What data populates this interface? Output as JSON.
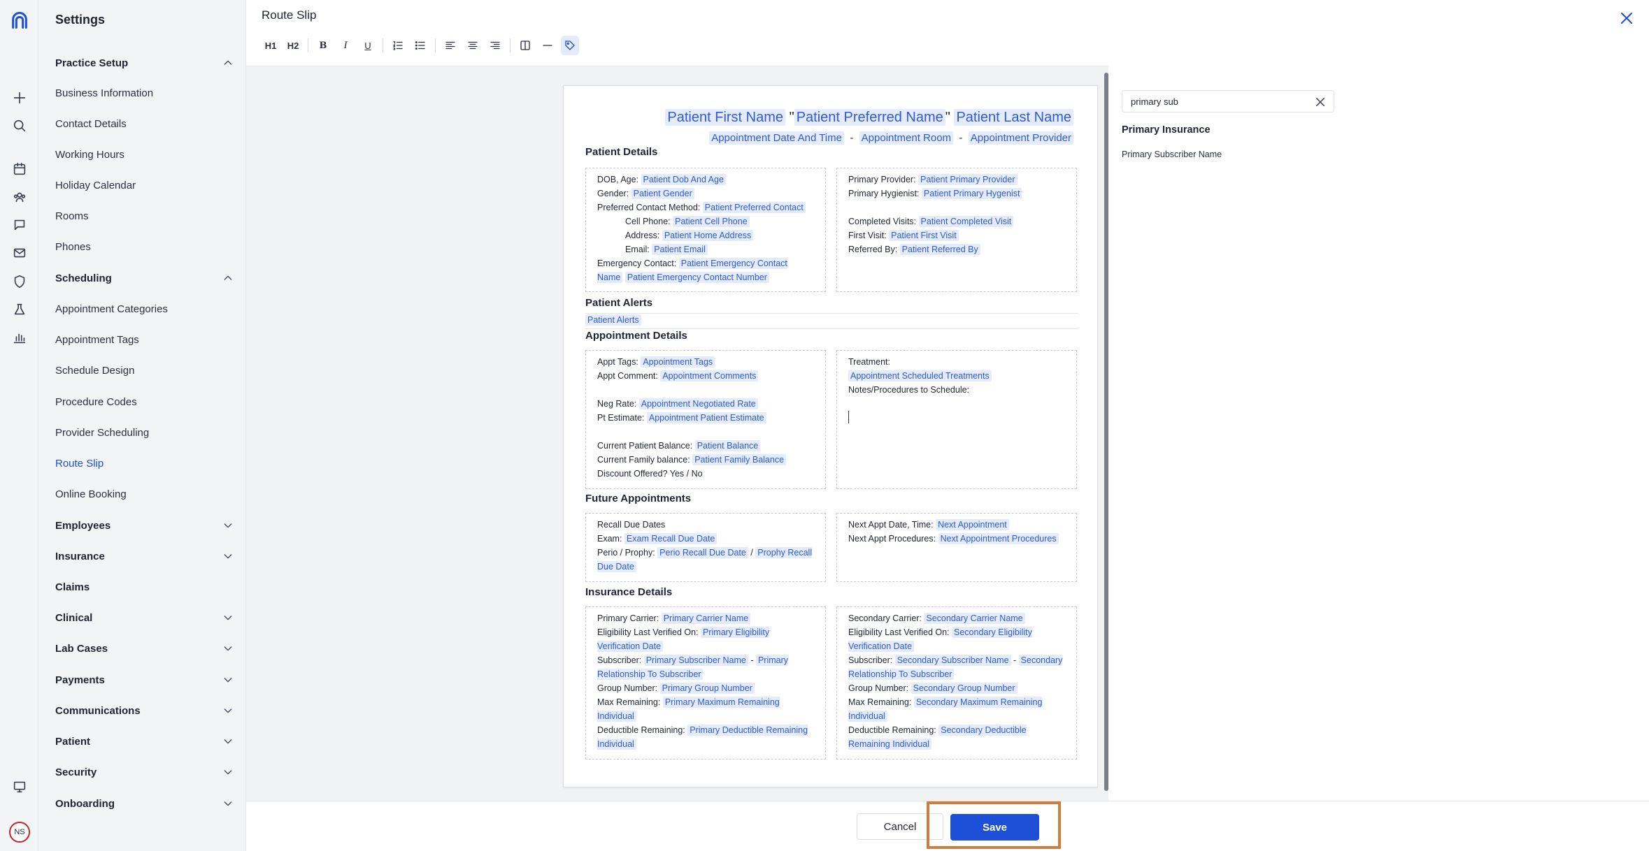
{
  "sidebar": {
    "title": "Settings",
    "avatar_initials": "NS",
    "items": [
      {
        "label": "Practice Setup",
        "type": "section",
        "chevron": "up"
      },
      {
        "label": "Business Information",
        "type": "item"
      },
      {
        "label": "Contact Details",
        "type": "item"
      },
      {
        "label": "Working Hours",
        "type": "item"
      },
      {
        "label": "Holiday Calendar",
        "type": "item"
      },
      {
        "label": "Rooms",
        "type": "item"
      },
      {
        "label": "Phones",
        "type": "item"
      },
      {
        "label": "Scheduling",
        "type": "section",
        "chevron": "up"
      },
      {
        "label": "Appointment Categories",
        "type": "item"
      },
      {
        "label": "Appointment Tags",
        "type": "item"
      },
      {
        "label": "Schedule Design",
        "type": "item"
      },
      {
        "label": "Procedure Codes",
        "type": "item"
      },
      {
        "label": "Provider Scheduling",
        "type": "item"
      },
      {
        "label": "Route Slip",
        "type": "item",
        "active": true
      },
      {
        "label": "Online Booking",
        "type": "item"
      },
      {
        "label": "Employees",
        "type": "section",
        "chevron": "down"
      },
      {
        "label": "Insurance",
        "type": "section",
        "chevron": "down"
      },
      {
        "label": "Claims",
        "type": "section"
      },
      {
        "label": "Clinical",
        "type": "section",
        "chevron": "down"
      },
      {
        "label": "Lab Cases",
        "type": "section",
        "chevron": "down"
      },
      {
        "label": "Payments",
        "type": "section",
        "chevron": "down"
      },
      {
        "label": "Communications",
        "type": "section",
        "chevron": "down"
      },
      {
        "label": "Patient",
        "type": "section",
        "chevron": "down"
      },
      {
        "label": "Security",
        "type": "section",
        "chevron": "down"
      },
      {
        "label": "Onboarding",
        "type": "section",
        "chevron": "down"
      }
    ]
  },
  "rail_icons": [
    "app-logo-icon",
    "plus-icon",
    "search-icon",
    "schedule-icon",
    "patients-icon",
    "chat-icon",
    "mail-icon",
    "shield-icon",
    "lab-flask-icon",
    "reports-chart-icon",
    "desktop-icon"
  ],
  "editor": {
    "title": "Route Slip",
    "toolbar": {
      "h1": "H1",
      "h2": "H2",
      "bold": "B",
      "italic": "I",
      "underline": "U"
    },
    "colors": {
      "accent": "#1d4fd8",
      "tag_bg": "#e4ebfa",
      "tag_text": "#2f5bd6",
      "save_highlight": "#d07d3c"
    }
  },
  "doc": {
    "header": {
      "first_name": "Patient First Name",
      "quote": "\"",
      "preferred_name": "Patient Preferred Name",
      "last_name": "Patient Last Name",
      "appt_date": "Appointment Date And Time",
      "dash": "-",
      "appt_room": "Appointment Room",
      "appt_provider": "Appointment Provider"
    },
    "patient_details": {
      "title": "Patient Details",
      "dob_label": "DOB, Age:",
      "dob_tag": "Patient Dob And Age",
      "gender_label": "Gender:",
      "gender_tag": "Patient Gender",
      "pref_label": "Preferred Contact Method:",
      "pref_tag": "Patient Preferred Contact",
      "cell_label": "Cell Phone:",
      "cell_tag": "Patient Cell Phone",
      "address_label": "Address:",
      "address_tag": "Patient Home Address",
      "email_label": "Email:",
      "email_tag": "Patient Email",
      "emerg_label": "Emergency Contact:",
      "emerg_tag1": "Patient Emergency Contact Name",
      "emerg_tag2": "Patient Emergency Contact Number",
      "prov_label": "Primary Provider:",
      "prov_tag": "Patient Primary Provider",
      "hyg_label": "Primary Hygienist:",
      "hyg_tag": "Patient Primary Hygenist",
      "visits_label": "Completed Visits:",
      "visits_tag": "Patient Completed Visit",
      "first_label": "First Visit:",
      "first_tag": "Patient First Visit",
      "ref_label": "Referred By:",
      "ref_tag": "Patient Referred By"
    },
    "alerts": {
      "title": "Patient Alerts",
      "tag": "Patient Alerts"
    },
    "appointment_details": {
      "title": "Appointment Details",
      "tags_label": "Appt Tags:",
      "tags_tag": "Appointment Tags",
      "comment_label": "Appt Comment:",
      "comment_tag": "Appointment Comments",
      "neg_label": "Neg Rate:",
      "neg_tag": "Appointment Negotiated Rate",
      "est_label": "Pt Estimate:",
      "est_tag": "Appointment Patient Estimate",
      "bal_label": "Current Patient Balance:",
      "bal_tag": "Patient Balance",
      "fam_label": "Current Family balance:",
      "fam_tag": "Patient Family Balance",
      "disc_label": "Discount Offered?",
      "disc_value": "Yes / No",
      "treat_label": "Treatment:",
      "treat_tag": "Appointment Scheduled Treatments",
      "notes_label": "Notes/Procedures to Schedule:"
    },
    "future": {
      "title": "Future Appointments",
      "recall_label": "Recall Due Dates",
      "exam_label": "Exam:",
      "exam_tag": "Exam Recall Due Date",
      "perio_label": "Perio / Prophy:",
      "perio_tag": "Perio Recall Due Date",
      "slash": "/",
      "prophy_tag": "Prophy Recall Due Date",
      "next_label": "Next Appt Date, Time:",
      "next_tag": "Next Appointment",
      "next_proc_label": "Next Appt Procedures:",
      "next_proc_tag": "Next Appointment Procedures"
    },
    "insurance": {
      "title": "Insurance Details",
      "p_carrier_label": "Primary Carrier:",
      "p_carrier_tag": "Primary Carrier Name",
      "p_elig_label": "Eligibility Last Verified On:",
      "p_elig_tag": "Primary Eligibility Verification Date",
      "p_sub_label": "Subscriber:",
      "p_sub_tag": "Primary Subscriber Name",
      "p_rel_tag": "Primary Relationship To Subscriber",
      "p_group_label": "Group Number:",
      "p_group_tag": "Primary Group Number",
      "p_max_label": "Max Remaining:",
      "p_max_tag": "Primary Maximum Remaining Individual",
      "p_ded_label": "Deductible Remaining:",
      "p_ded_tag": "Primary Deductible Remaining Individual",
      "s_carrier_label": "Secondary Carrier:",
      "s_carrier_tag": "Secondary Carrier Name",
      "s_elig_label": "Eligibility Last Verified On:",
      "s_elig_tag": "Secondary Eligibility Verification Date",
      "s_sub_label": "Subscriber:",
      "s_sub_tag": "Secondary Subscriber Name",
      "s_rel_tag": "Secondary Relationship To Subscriber",
      "s_group_label": "Group Number:",
      "s_group_tag": "Secondary Group Number",
      "s_max_label": "Max Remaining:",
      "s_max_tag": "Secondary Maximum Remaining Individual",
      "s_ded_label": "Deductible Remaining:",
      "s_ded_tag": "Secondary Deductible Remaining Individual"
    }
  },
  "right_panel": {
    "search_value": "primary sub",
    "result_group": "Primary Insurance",
    "result_item": "Primary Subscriber Name"
  },
  "footer": {
    "cancel": "Cancel",
    "save": "Save"
  }
}
